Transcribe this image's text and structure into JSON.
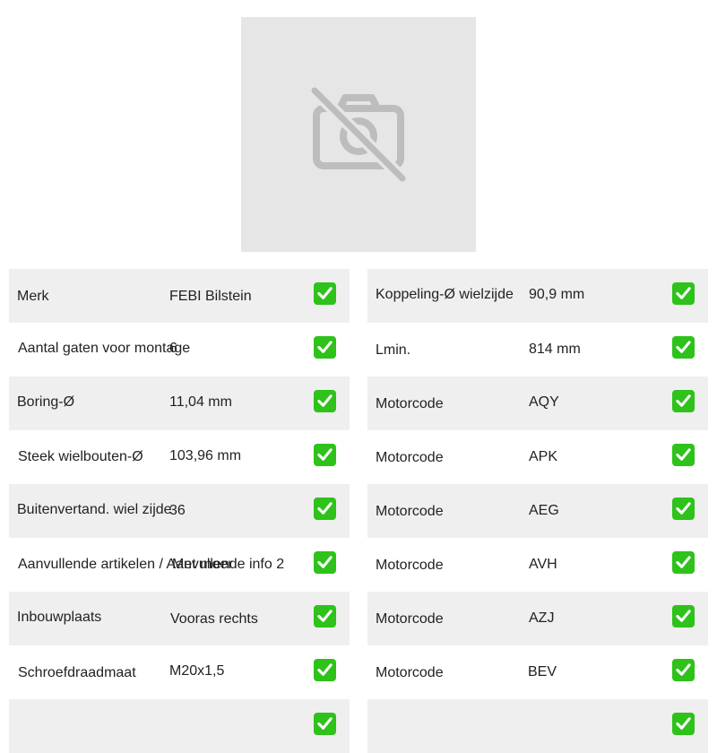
{
  "image": {
    "icon": "camera-off-icon"
  },
  "colors": {
    "check": "#2ec21b",
    "shade": "#efefef",
    "placeholder": "#e6e6e6"
  },
  "left": [
    {
      "label": "Merk",
      "value": "FEBI Bilstein"
    },
    {
      "label": "Aantal gaten voor montage",
      "value": "6"
    },
    {
      "label": "Boring-Ø",
      "value": "11,04 mm"
    },
    {
      "label": "Steek wielbouten-Ø",
      "value": "103,96 mm"
    },
    {
      "label": "Buitenvertand. wiel zijde",
      "value": "36"
    },
    {
      "label": "Aanvullende artikelen / Aanvullende info 2",
      "value": "Met moer"
    },
    {
      "label": "Inbouwplaats",
      "value": "Vooras rechts"
    },
    {
      "label": "Schroefdraadmaat",
      "value": "M20x1,5"
    },
    {
      "label": "",
      "value": ""
    }
  ],
  "right": [
    {
      "label": "Koppeling-Ø wielzijde",
      "value": "90,9 mm"
    },
    {
      "label": "Lmin.",
      "value": "814 mm"
    },
    {
      "label": "Motorcode",
      "value": "AQY"
    },
    {
      "label": "Motorcode",
      "value": "APK"
    },
    {
      "label": "Motorcode",
      "value": "AEG"
    },
    {
      "label": "Motorcode",
      "value": "AVH"
    },
    {
      "label": "Motorcode",
      "value": "AZJ"
    },
    {
      "label": "Motorcode",
      "value": "BEV"
    },
    {
      "label": "",
      "value": ""
    }
  ]
}
